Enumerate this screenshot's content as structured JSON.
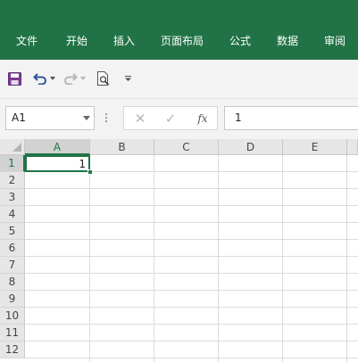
{
  "ribbon": {
    "tabs": [
      {
        "label": "文件"
      },
      {
        "label": "开始"
      },
      {
        "label": "插入"
      },
      {
        "label": "页面布局"
      },
      {
        "label": "公式"
      },
      {
        "label": "数据"
      },
      {
        "label": "审阅"
      }
    ]
  },
  "quick_access": {
    "items": [
      "save-icon",
      "undo-icon",
      "undo-dropdown-icon",
      "redo-icon",
      "redo-dropdown-icon",
      "print-preview-icon",
      "customize-toolbar-icon"
    ]
  },
  "formula_bar": {
    "name_box": "A1",
    "cancel_symbol": "✕",
    "enter_symbol": "✓",
    "fx_label": "fx",
    "content": "1"
  },
  "sheet": {
    "columns": [
      "A",
      "B",
      "C",
      "D",
      "E"
    ],
    "rows": [
      "1",
      "2",
      "3",
      "4",
      "5",
      "6",
      "7",
      "8",
      "9",
      "10",
      "11",
      "12"
    ],
    "selected_cell": "A1",
    "cells": {
      "A1": "1"
    }
  },
  "colors": {
    "accent": "#217346",
    "ribbon": "#217346"
  }
}
